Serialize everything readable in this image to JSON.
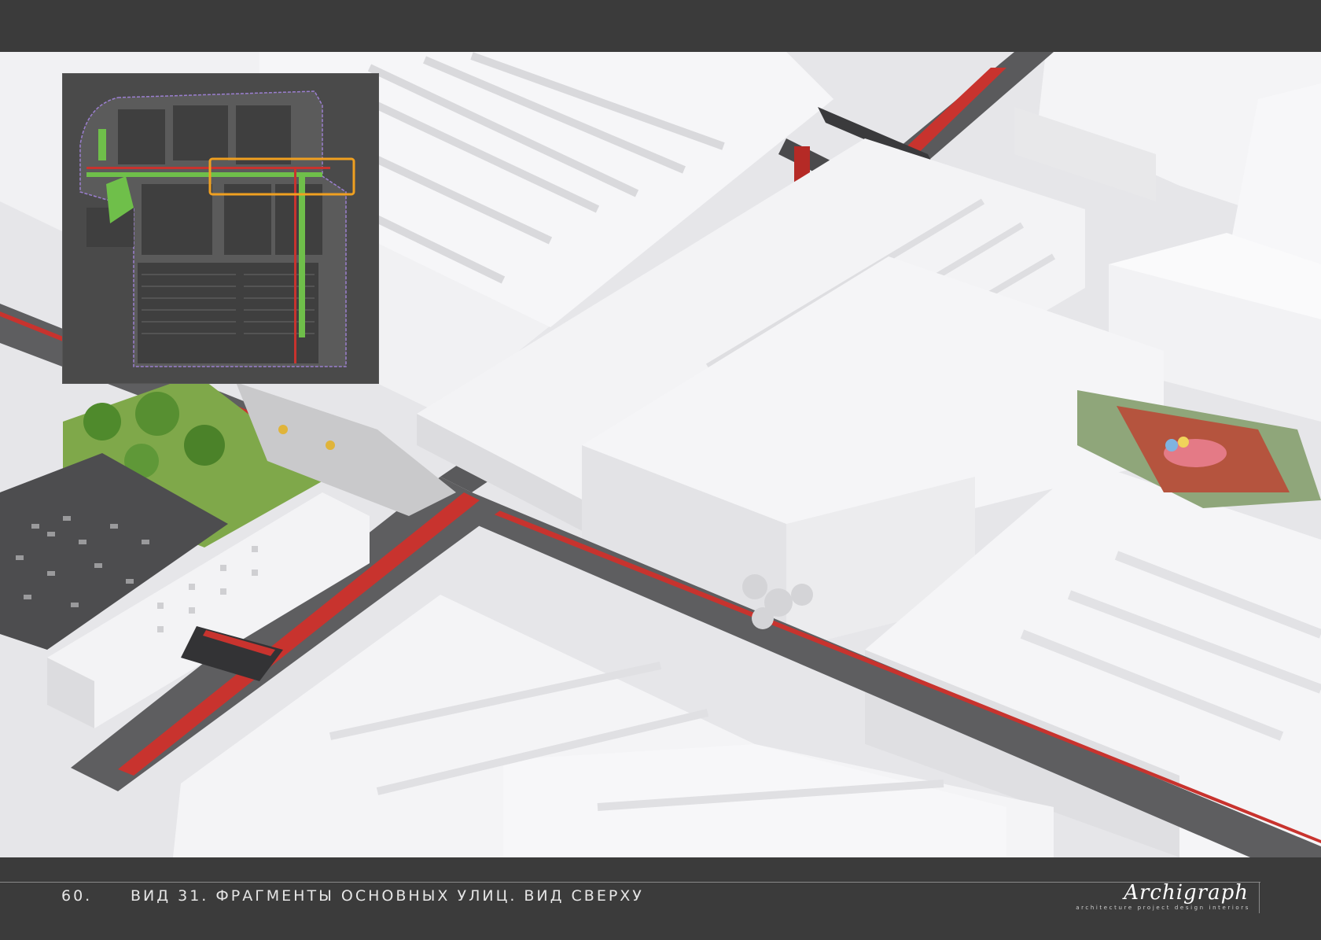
{
  "page": {
    "number": "60.",
    "caption": "ВИД 31. ФРАГМЕНТЫ ОСНОВНЫХ УЛИЦ. ВИД СВЕРХУ"
  },
  "logo": {
    "wordmark": "Archigraph",
    "tagline": "architecture  project  design  interiors"
  },
  "colors": {
    "frame": "#3b3b3b",
    "buildings": "#f4f4f6",
    "roads": "#5a5a5c",
    "cycle_lanes": "#c8332e",
    "greenery": "#6f9a3c",
    "inset_highlight": "#f0a020"
  }
}
